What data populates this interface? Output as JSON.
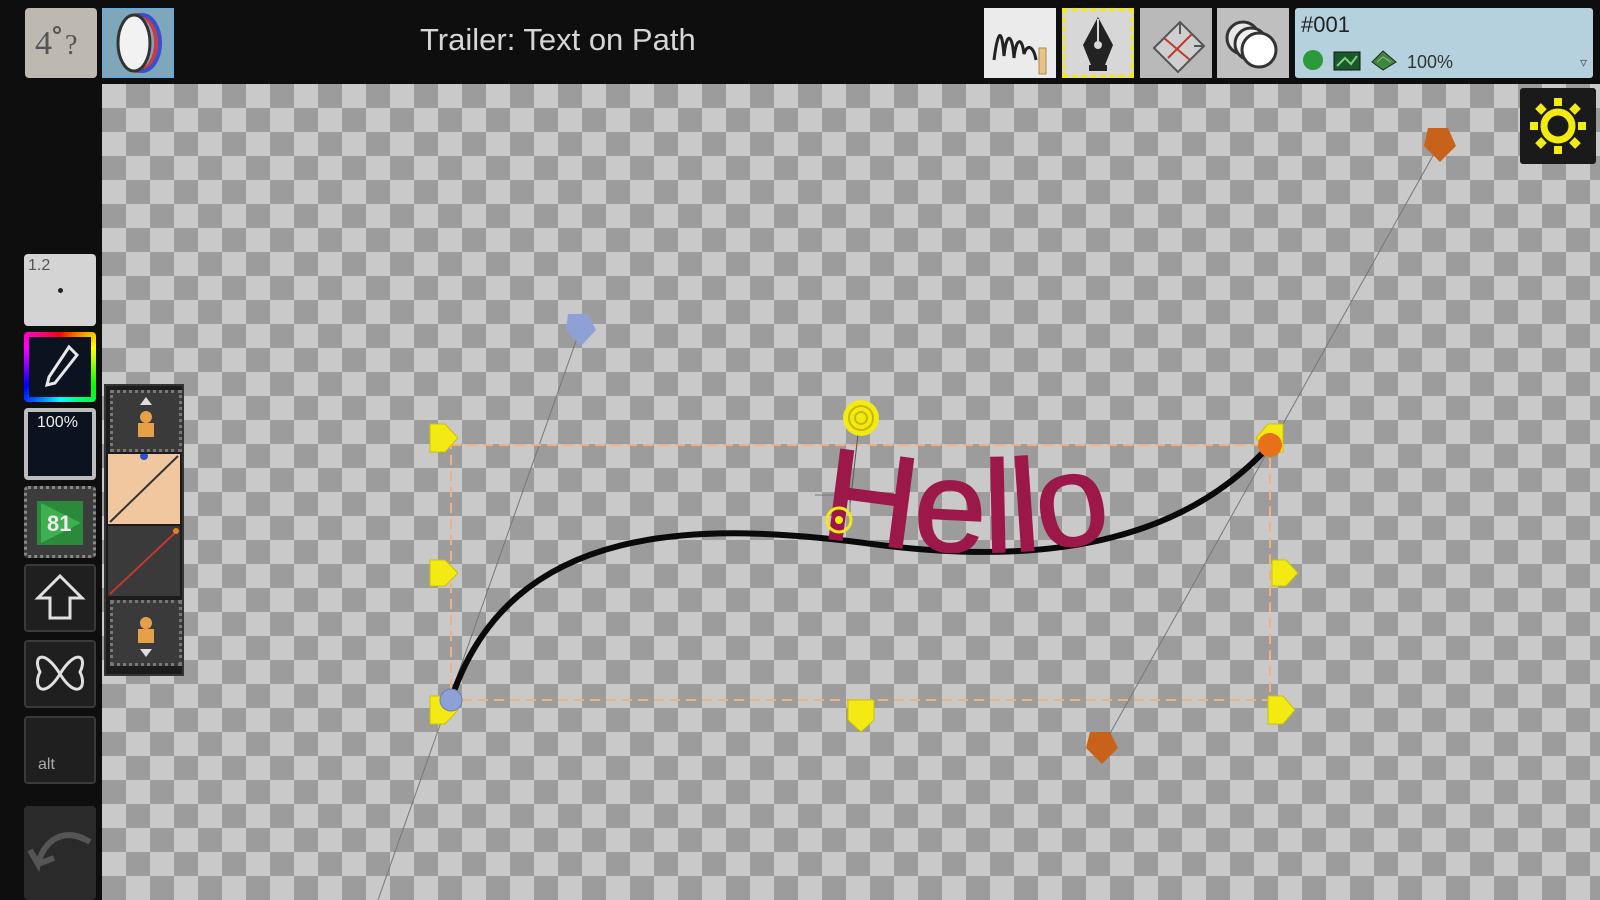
{
  "window": {
    "title": "Trailer: Text on Path"
  },
  "toolbar_right": {
    "tools": [
      {
        "name": "freehand-tool",
        "label": ""
      },
      {
        "name": "pen-tool",
        "label": ""
      },
      {
        "name": "transform-tool",
        "label": ""
      },
      {
        "name": "layers-tool",
        "label": ""
      }
    ],
    "layer_info": {
      "name": "#001",
      "opacity": "100%"
    }
  },
  "left_toolbar": {
    "brush_size": "1.2",
    "opacity": "100%",
    "frame_number": "81",
    "alt_label": "alt"
  },
  "canvas": {
    "text_on_path": "Hello",
    "text_color": "#9b1848",
    "path_color": "#0a0a0a",
    "handle_color_yellow": "#f2ea12",
    "handle_color_blue": "#8ea1d6",
    "handle_color_orange": "#c8621a"
  },
  "colors": {
    "accent_gear": "#f2ea12",
    "selected_tool_border": "#f2ea12",
    "layer_panel_bg": "#b5d1de"
  }
}
